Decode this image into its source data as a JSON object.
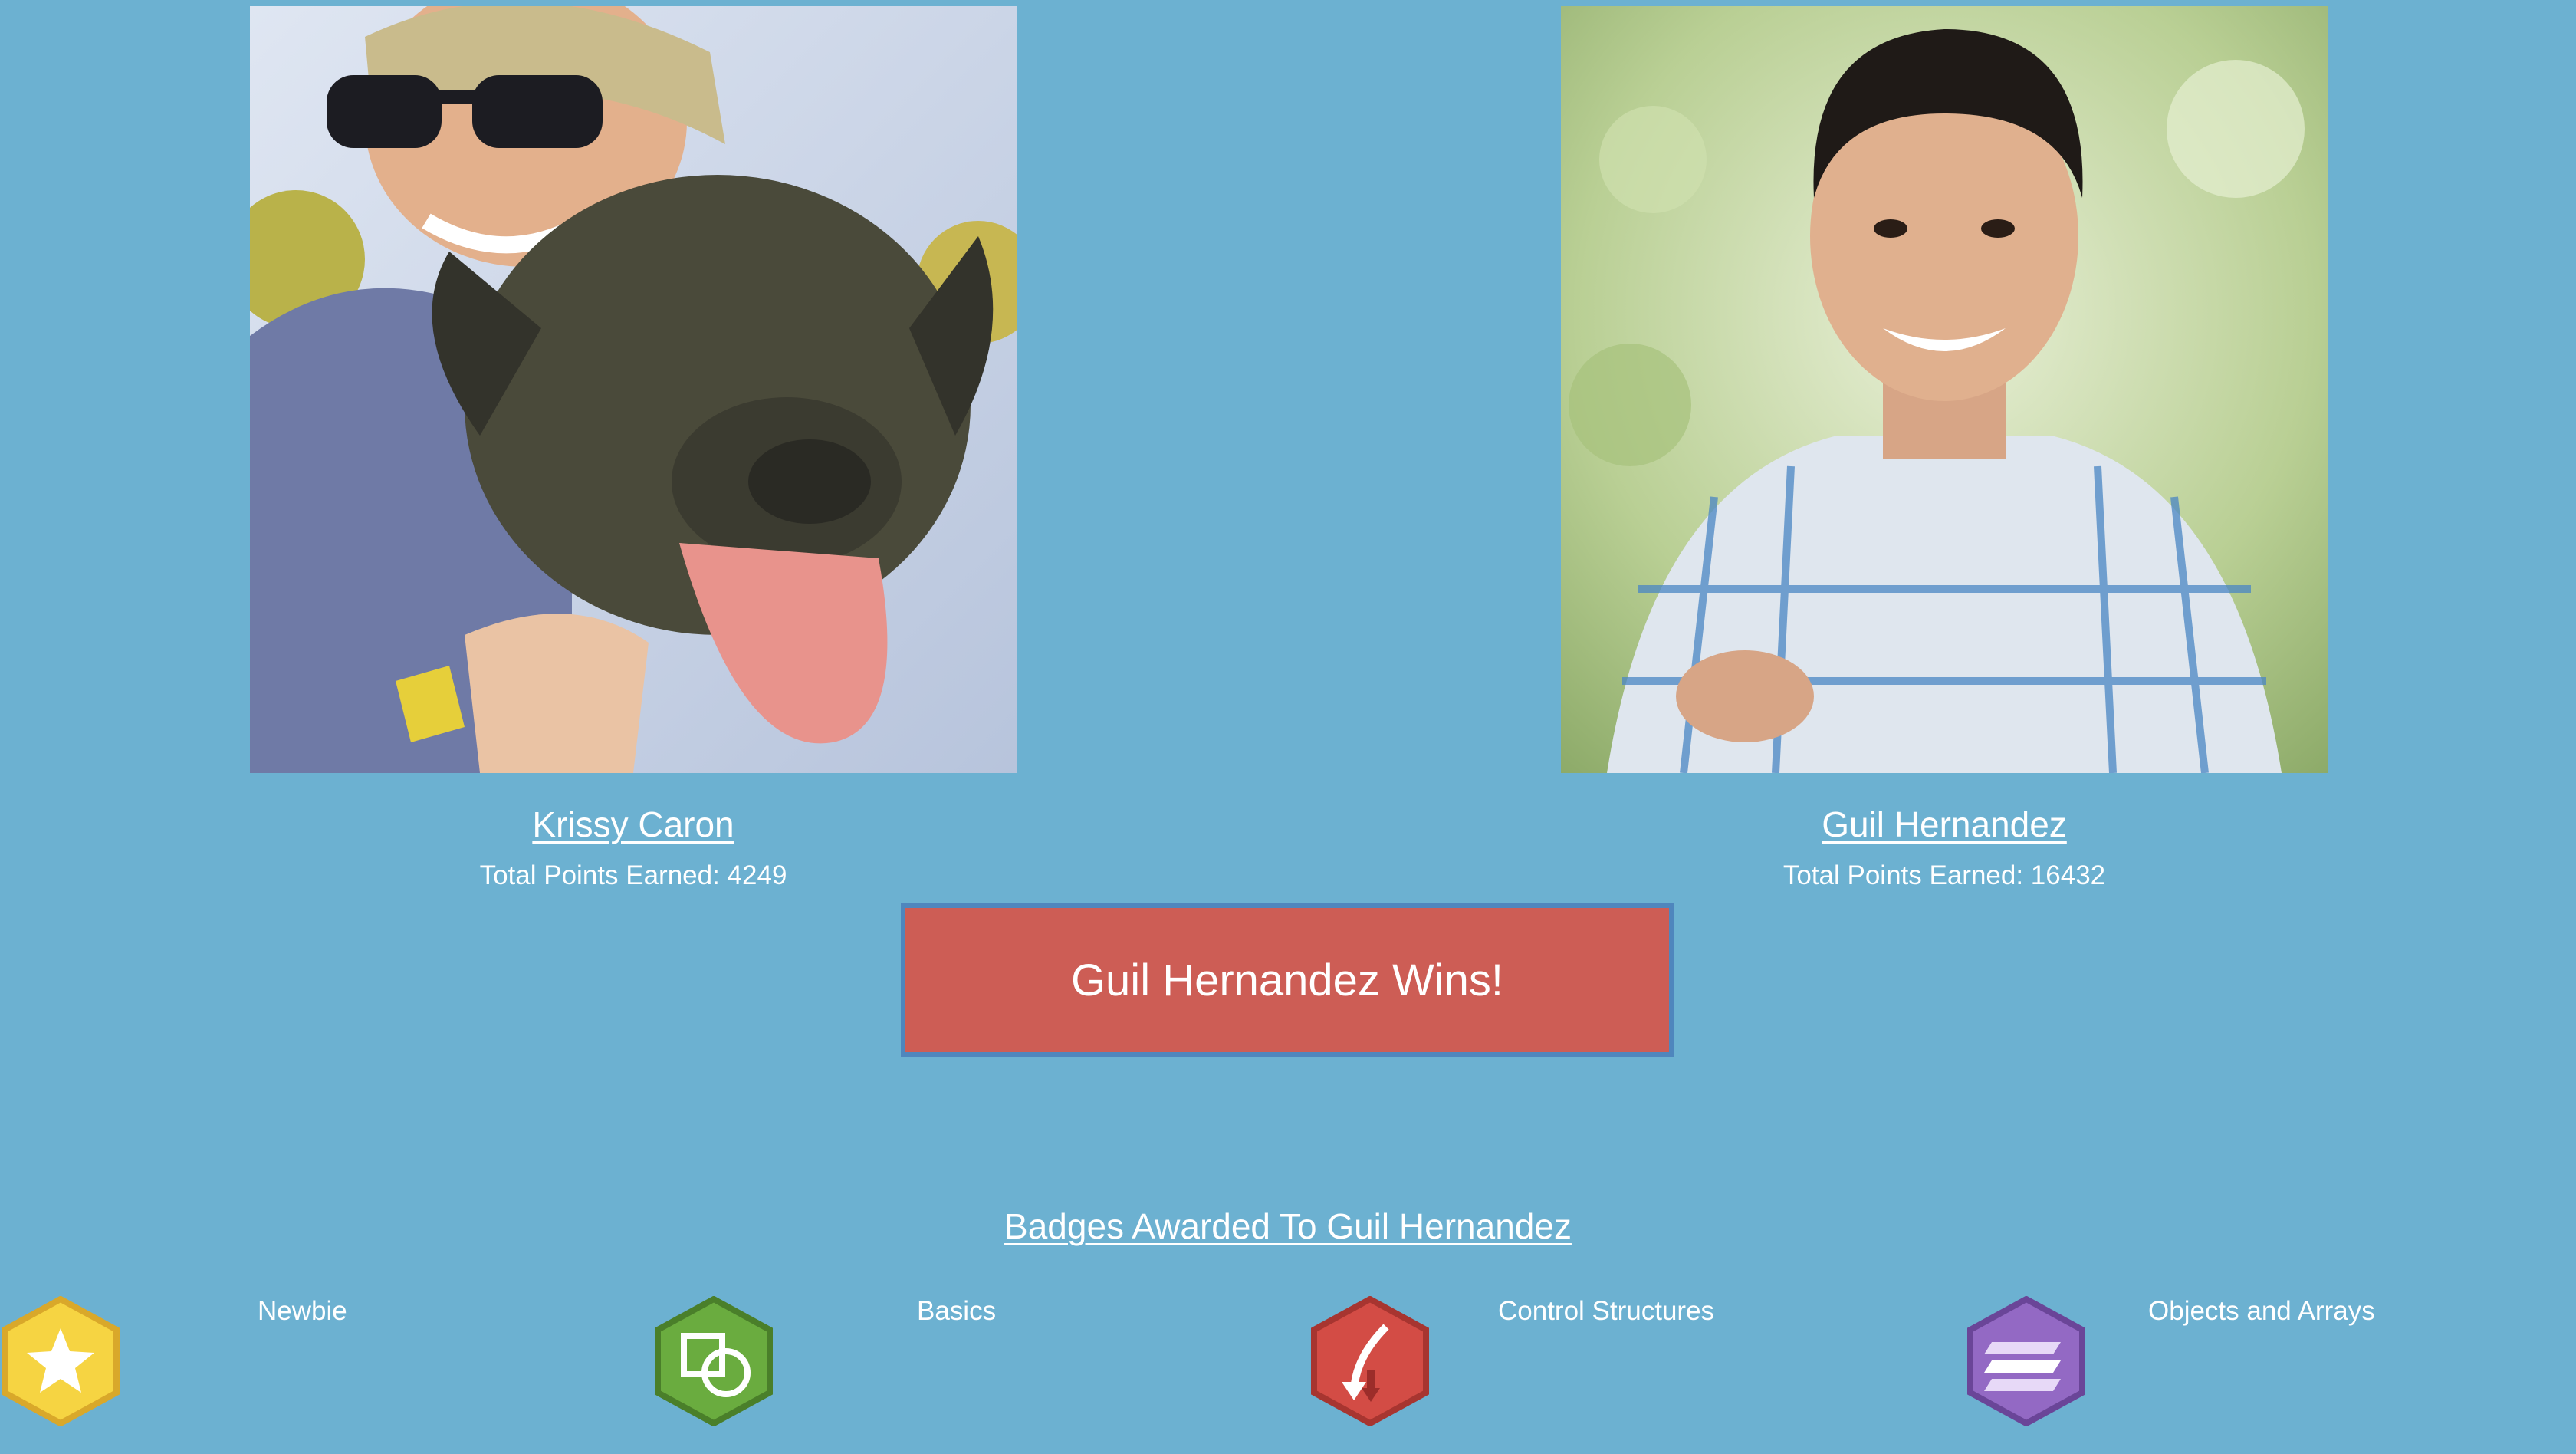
{
  "players": [
    {
      "name": "Krissy Caron",
      "points_label": "Total Points Earned: 4249"
    },
    {
      "name": "Guil Hernandez",
      "points_label": "Total Points Earned: 16432"
    }
  ],
  "winner_text": "Guil Hernandez Wins!",
  "badges_title": "Badges Awarded To Guil Hernandez",
  "badges": [
    {
      "label": "Newbie",
      "icon": "star-icon",
      "color": "#f4c430"
    },
    {
      "label": "Basics",
      "icon": "shapes-icon",
      "color": "#5a9a3a"
    },
    {
      "label": "Control Structures",
      "icon": "branch-arrow-icon",
      "color": "#c84b45"
    },
    {
      "label": "Objects and Arrays",
      "icon": "layers-icon",
      "color": "#8a5fb8"
    }
  ],
  "colors": {
    "background": "#6cb1d1",
    "winner_banner": "#cd5d55",
    "winner_border": "#4f86bd",
    "text": "#ffffff"
  }
}
